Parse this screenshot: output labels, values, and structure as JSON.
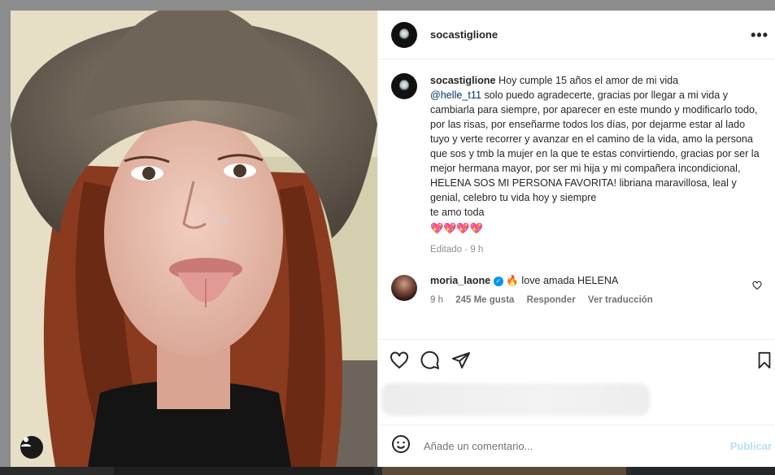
{
  "post": {
    "username": "socastiglione",
    "more_label": "•••",
    "caption_username": "socastiglione",
    "caption_pre": "Hoy cumple 15 años el amor de mi vida",
    "mention": "@helle_t11",
    "caption_body": "solo puedo agradecerte, gracias por llegar a mi vida y cambiarla para siempre, por aparecer en este mundo y modificarlo todo, por las risas, por enseñarme todos los días, por dejarme estar al lado tuyo y verte recorrer y avanzar en el camino de la vida, amo la persona que sos y tmb la mujer en la que te estas convirtiendo, gracias por ser la mejor hermana mayor, por ser mi hija y mi compañera incondicional, HELENA SOS MI PERSONA FAVORITA! libriana maravillosa, leal y genial, celebro tu vida hoy y siempre",
    "caption_end": "te amo toda",
    "emojis": "💖💖💖💖",
    "edited_meta": "Editado · 9 h"
  },
  "comment": {
    "username": "moria_laone",
    "verified_icon": "✓",
    "fire_emoji": "🔥",
    "text": "love amada HELENA",
    "time": "9 h",
    "likes": "245 Me gusta",
    "reply": "Responder",
    "translate": "Ver traducción"
  },
  "composer": {
    "placeholder": "Añade un comentario...",
    "publish": "Publicar"
  },
  "icons": [
    "heart-icon",
    "comment-icon",
    "share-icon",
    "bookmark-icon",
    "emoji-icon",
    "user-tag-icon",
    "more-icon"
  ],
  "colors": {
    "link": "#00376b",
    "publish_disabled": "#b2dffc",
    "verified": "#0095f6",
    "text": "#262626",
    "muted": "#8e8e8e"
  }
}
